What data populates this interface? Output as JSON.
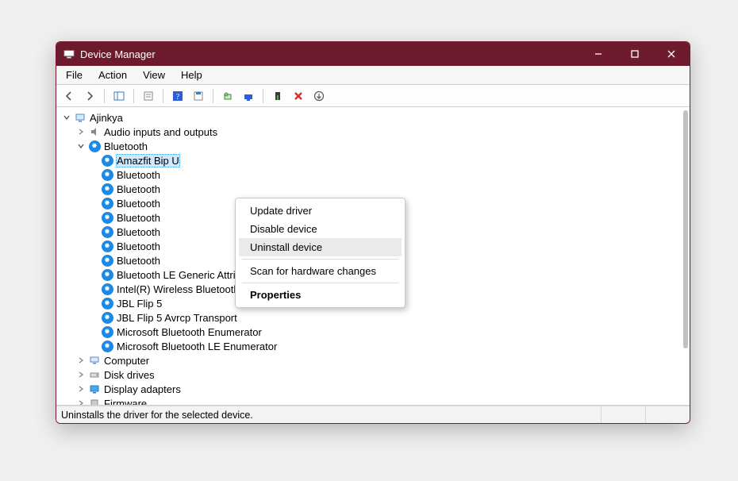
{
  "window": {
    "title": "Device Manager"
  },
  "menu": {
    "file": "File",
    "action": "Action",
    "view": "View",
    "help": "Help"
  },
  "tree": {
    "root": "Ajinkya",
    "cat_audio": "Audio inputs and outputs",
    "cat_bluetooth": "Bluetooth",
    "cat_computer": "Computer",
    "cat_disk": "Disk drives",
    "cat_display": "Display adapters",
    "cat_firmware": "Firmware",
    "bt": {
      "d0": "Amazfit Bip U",
      "d1": "Bluetooth",
      "d2": "Bluetooth",
      "d3": "Bluetooth",
      "d4": "Bluetooth",
      "d5": "Bluetooth",
      "d6": "Bluetooth",
      "d7": "Bluetooth",
      "d8": "Bluetooth LE Generic Attribute Service",
      "d9": "Intel(R) Wireless Bluetooth(R)",
      "d10": "JBL Flip 5",
      "d11": "JBL Flip 5 Avrcp Transport",
      "d12": "Microsoft Bluetooth Enumerator",
      "d13": "Microsoft Bluetooth LE Enumerator"
    }
  },
  "context_menu": {
    "update": "Update driver",
    "disable": "Disable device",
    "uninstall": "Uninstall device",
    "scan": "Scan for hardware changes",
    "properties": "Properties"
  },
  "status": {
    "text": "Uninstalls the driver for the selected device."
  }
}
